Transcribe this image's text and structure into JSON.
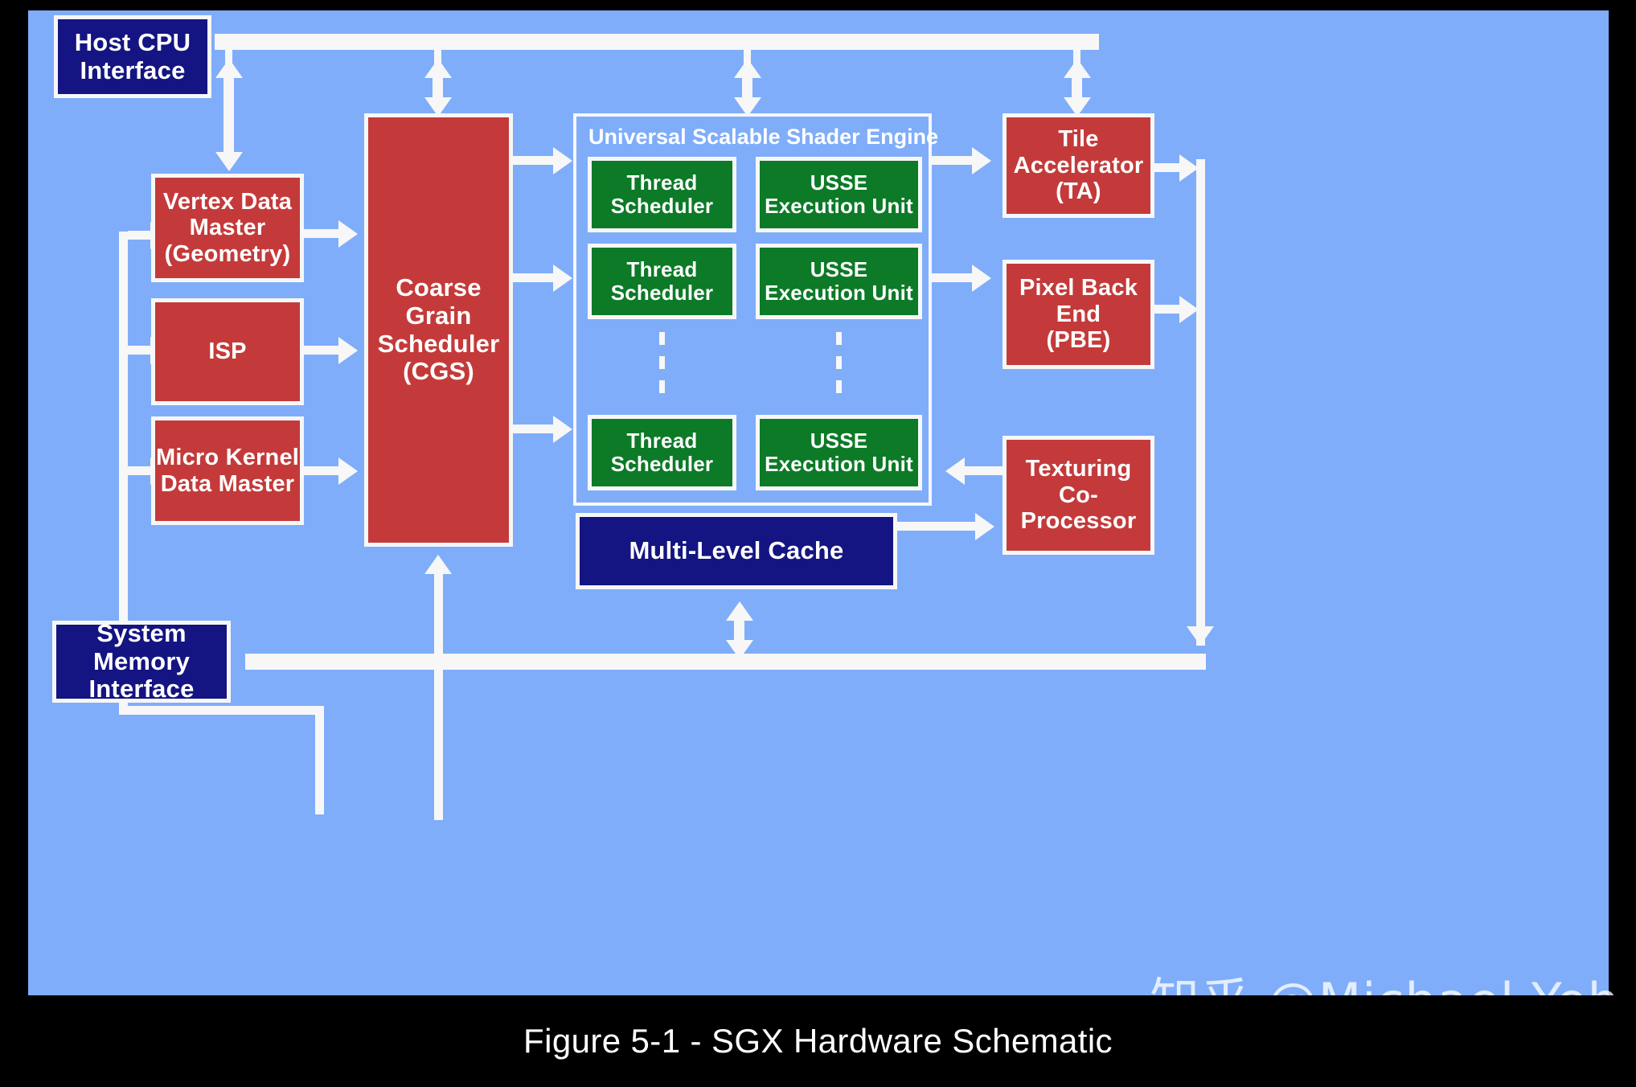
{
  "figure": {
    "caption": "Figure 5-1 - SGX Hardware Schematic",
    "watermark": "知乎 @Michael Yeh",
    "background_color": "#7FADFA",
    "caption_band_color": "#000000"
  },
  "palette": {
    "navy": "#141482",
    "red": "#C43A3A",
    "green": "#0C7A27",
    "connector": "#F7F7F7",
    "canvas": "#7FADFA"
  },
  "interfaces": {
    "host_cpu": "Host CPU\nInterface",
    "host_cpu_line1": "Host CPU",
    "host_cpu_line2": "Interface",
    "system_memory_line1": "System Memory",
    "system_memory_line2": "Interface"
  },
  "data_masters": [
    {
      "line1": "Vertex Data",
      "line2": "Master",
      "line3": "(Geometry)"
    },
    {
      "line1": "ISP",
      "line2": "",
      "line3": ""
    },
    {
      "line1": "Micro Kernel",
      "line2": "Data Master",
      "line3": ""
    }
  ],
  "scheduler": {
    "line1": "Coarse",
    "line2": "Grain",
    "line3": "Scheduler",
    "line4": "(CGS)"
  },
  "shader_engine": {
    "title": "Universal Scalable Shader Engine",
    "rows": [
      {
        "scheduler_line1": "Thread",
        "scheduler_line2": "Scheduler",
        "usse_line1": "USSE",
        "usse_line2": "Execution Unit"
      },
      {
        "scheduler_line1": "Thread",
        "scheduler_line2": "Scheduler",
        "usse_line1": "USSE",
        "usse_line2": "Execution Unit"
      },
      {
        "scheduler_line1": "Thread",
        "scheduler_line2": "Scheduler",
        "usse_line1": "USSE",
        "usse_line2": "Execution Unit"
      }
    ]
  },
  "backend": {
    "tile_accelerator_line1": "Tile",
    "tile_accelerator_line2": "Accelerator",
    "tile_accelerator_line3": "(TA)",
    "pixel_back_end_line1": "Pixel Back",
    "pixel_back_end_line2": "End",
    "pixel_back_end_line3": "(PBE)",
    "texturing_line1": "Texturing",
    "texturing_line2": "Co-",
    "texturing_line3": "Processor"
  },
  "cache": {
    "label": "Multi-Level Cache"
  }
}
